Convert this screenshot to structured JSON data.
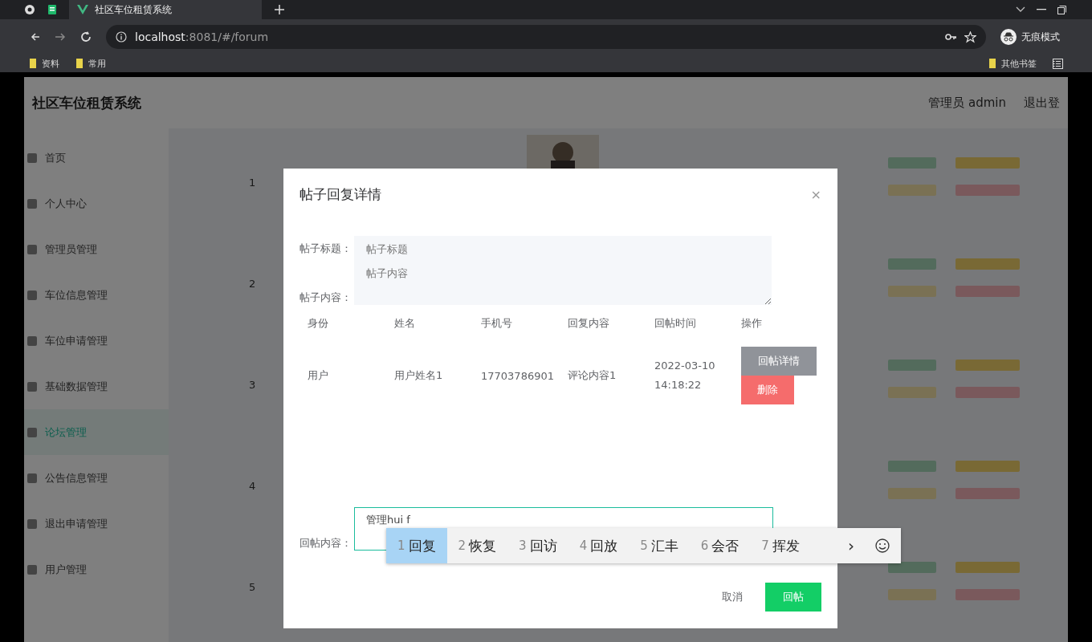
{
  "browser": {
    "tab_title": "社区车位租赁系统",
    "url_host": "localhost",
    "url_path": ":8081/#/forum",
    "incognito_label": "无痕模式",
    "bookmarks": [
      "资料",
      "常用"
    ],
    "other_bookmarks": "其他书签"
  },
  "app": {
    "title": "社区车位租赁系统",
    "user_label": "管理员 admin",
    "logout": "退出登"
  },
  "sidebar": {
    "items": [
      {
        "label": "首页",
        "selected": false
      },
      {
        "label": "个人中心",
        "selected": false
      },
      {
        "label": "管理员管理",
        "selected": false
      },
      {
        "label": "车位信息管理",
        "selected": false
      },
      {
        "label": "车位申请管理",
        "selected": false
      },
      {
        "label": "基础数据管理",
        "selected": false
      },
      {
        "label": "论坛管理",
        "selected": true
      },
      {
        "label": "公告信息管理",
        "selected": false
      },
      {
        "label": "退出申请管理",
        "selected": false
      },
      {
        "label": "用户管理",
        "selected": false
      }
    ]
  },
  "rows": [
    {
      "index": "1"
    },
    {
      "index": "2"
    },
    {
      "index": "3"
    },
    {
      "index": "4"
    },
    {
      "index": "5"
    }
  ],
  "modal": {
    "title": "帖子回复详情",
    "close": "×",
    "fields": [
      {
        "label": "帖子标题：",
        "placeholder": "帖子标题"
      },
      {
        "label": "帖子内容：",
        "placeholder": "帖子内容"
      }
    ],
    "columns": [
      "身份",
      "姓名",
      "手机号",
      "回复内容",
      "回帖时间",
      "操作"
    ],
    "replies": [
      {
        "role": "用户",
        "name": "用户姓名1",
        "phone": "17703786901",
        "content": "评论内容1",
        "time": "2022-03-10 14:18:22",
        "detail_button": "回帖详情",
        "delete_button": "删除"
      }
    ],
    "reply_label": "回帖内容：",
    "reply_value": "管理hui f",
    "cancel": "取消",
    "submit": "回帖"
  },
  "ime": {
    "candidates": [
      {
        "number": "1",
        "text": "回复",
        "selected": true
      },
      {
        "number": "2",
        "text": "恢复",
        "selected": false
      },
      {
        "number": "3",
        "text": "回访",
        "selected": false
      },
      {
        "number": "4",
        "text": "回放",
        "selected": false
      },
      {
        "number": "5",
        "text": "汇丰",
        "selected": false
      },
      {
        "number": "6",
        "text": "会否",
        "selected": false
      },
      {
        "number": "7",
        "text": "挥发",
        "selected": false
      }
    ],
    "next": "›"
  }
}
